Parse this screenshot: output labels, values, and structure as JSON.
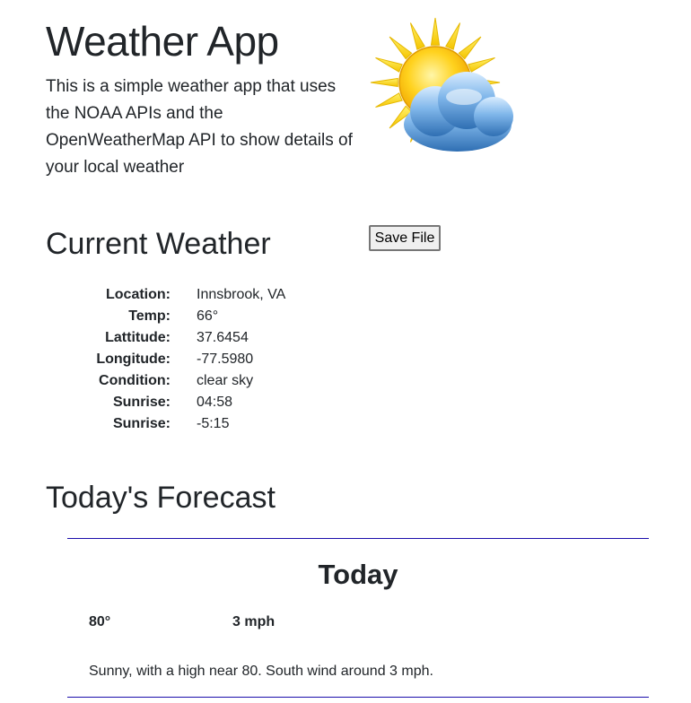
{
  "header": {
    "title": "Weather App",
    "description": "This is a simple weather app that uses the NOAA APIs and the OpenWeatherMap API to show details of your local weather",
    "logo_icon": "partly-cloudy-icon"
  },
  "current": {
    "title": "Current Weather",
    "save_label": "Save File",
    "details": [
      {
        "label": "Location:",
        "value": "Innsbrook, VA"
      },
      {
        "label": "Temp:",
        "value": "66°"
      },
      {
        "label": "Lattitude:",
        "value": "37.6454"
      },
      {
        "label": "Longitude:",
        "value": "-77.5980"
      },
      {
        "label": "Condition:",
        "value": "clear sky"
      },
      {
        "label": "Sunrise:",
        "value": "04:58"
      },
      {
        "label": "Sunrise:",
        "value": "-5:15"
      }
    ]
  },
  "forecast": {
    "title": "Today's Forecast",
    "period": {
      "name": "Today",
      "temperature": "80°",
      "wind": "3 mph",
      "description": "Sunny, with a high near 80. South wind around 3 mph."
    }
  },
  "colors": {
    "text": "#212529",
    "card_border": "#1a0dab",
    "sun": "#ffd21e",
    "cloud": "#4a8fd0"
  }
}
